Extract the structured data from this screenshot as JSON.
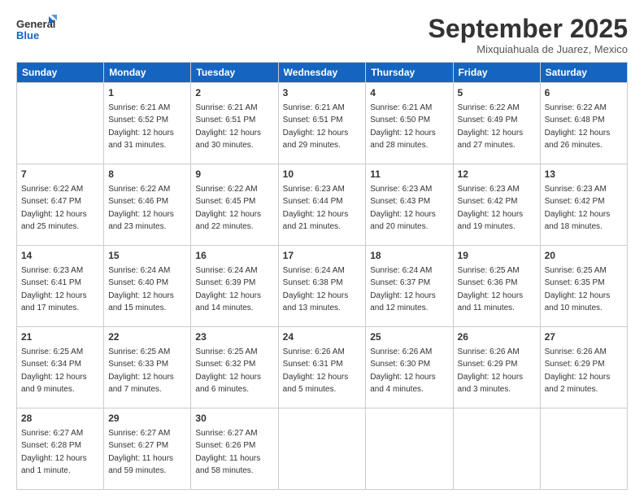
{
  "logo": {
    "line1": "General",
    "line2": "Blue"
  },
  "title": "September 2025",
  "subtitle": "Mixquiahuala de Juarez, Mexico",
  "days_of_week": [
    "Sunday",
    "Monday",
    "Tuesday",
    "Wednesday",
    "Thursday",
    "Friday",
    "Saturday"
  ],
  "weeks": [
    [
      {
        "day": "",
        "info": ""
      },
      {
        "day": "1",
        "info": "Sunrise: 6:21 AM\nSunset: 6:52 PM\nDaylight: 12 hours\nand 31 minutes."
      },
      {
        "day": "2",
        "info": "Sunrise: 6:21 AM\nSunset: 6:51 PM\nDaylight: 12 hours\nand 30 minutes."
      },
      {
        "day": "3",
        "info": "Sunrise: 6:21 AM\nSunset: 6:51 PM\nDaylight: 12 hours\nand 29 minutes."
      },
      {
        "day": "4",
        "info": "Sunrise: 6:21 AM\nSunset: 6:50 PM\nDaylight: 12 hours\nand 28 minutes."
      },
      {
        "day": "5",
        "info": "Sunrise: 6:22 AM\nSunset: 6:49 PM\nDaylight: 12 hours\nand 27 minutes."
      },
      {
        "day": "6",
        "info": "Sunrise: 6:22 AM\nSunset: 6:48 PM\nDaylight: 12 hours\nand 26 minutes."
      }
    ],
    [
      {
        "day": "7",
        "info": "Sunrise: 6:22 AM\nSunset: 6:47 PM\nDaylight: 12 hours\nand 25 minutes."
      },
      {
        "day": "8",
        "info": "Sunrise: 6:22 AM\nSunset: 6:46 PM\nDaylight: 12 hours\nand 23 minutes."
      },
      {
        "day": "9",
        "info": "Sunrise: 6:22 AM\nSunset: 6:45 PM\nDaylight: 12 hours\nand 22 minutes."
      },
      {
        "day": "10",
        "info": "Sunrise: 6:23 AM\nSunset: 6:44 PM\nDaylight: 12 hours\nand 21 minutes."
      },
      {
        "day": "11",
        "info": "Sunrise: 6:23 AM\nSunset: 6:43 PM\nDaylight: 12 hours\nand 20 minutes."
      },
      {
        "day": "12",
        "info": "Sunrise: 6:23 AM\nSunset: 6:42 PM\nDaylight: 12 hours\nand 19 minutes."
      },
      {
        "day": "13",
        "info": "Sunrise: 6:23 AM\nSunset: 6:42 PM\nDaylight: 12 hours\nand 18 minutes."
      }
    ],
    [
      {
        "day": "14",
        "info": "Sunrise: 6:23 AM\nSunset: 6:41 PM\nDaylight: 12 hours\nand 17 minutes."
      },
      {
        "day": "15",
        "info": "Sunrise: 6:24 AM\nSunset: 6:40 PM\nDaylight: 12 hours\nand 15 minutes."
      },
      {
        "day": "16",
        "info": "Sunrise: 6:24 AM\nSunset: 6:39 PM\nDaylight: 12 hours\nand 14 minutes."
      },
      {
        "day": "17",
        "info": "Sunrise: 6:24 AM\nSunset: 6:38 PM\nDaylight: 12 hours\nand 13 minutes."
      },
      {
        "day": "18",
        "info": "Sunrise: 6:24 AM\nSunset: 6:37 PM\nDaylight: 12 hours\nand 12 minutes."
      },
      {
        "day": "19",
        "info": "Sunrise: 6:25 AM\nSunset: 6:36 PM\nDaylight: 12 hours\nand 11 minutes."
      },
      {
        "day": "20",
        "info": "Sunrise: 6:25 AM\nSunset: 6:35 PM\nDaylight: 12 hours\nand 10 minutes."
      }
    ],
    [
      {
        "day": "21",
        "info": "Sunrise: 6:25 AM\nSunset: 6:34 PM\nDaylight: 12 hours\nand 9 minutes."
      },
      {
        "day": "22",
        "info": "Sunrise: 6:25 AM\nSunset: 6:33 PM\nDaylight: 12 hours\nand 7 minutes."
      },
      {
        "day": "23",
        "info": "Sunrise: 6:25 AM\nSunset: 6:32 PM\nDaylight: 12 hours\nand 6 minutes."
      },
      {
        "day": "24",
        "info": "Sunrise: 6:26 AM\nSunset: 6:31 PM\nDaylight: 12 hours\nand 5 minutes."
      },
      {
        "day": "25",
        "info": "Sunrise: 6:26 AM\nSunset: 6:30 PM\nDaylight: 12 hours\nand 4 minutes."
      },
      {
        "day": "26",
        "info": "Sunrise: 6:26 AM\nSunset: 6:29 PM\nDaylight: 12 hours\nand 3 minutes."
      },
      {
        "day": "27",
        "info": "Sunrise: 6:26 AM\nSunset: 6:29 PM\nDaylight: 12 hours\nand 2 minutes."
      }
    ],
    [
      {
        "day": "28",
        "info": "Sunrise: 6:27 AM\nSunset: 6:28 PM\nDaylight: 12 hours\nand 1 minute."
      },
      {
        "day": "29",
        "info": "Sunrise: 6:27 AM\nSunset: 6:27 PM\nDaylight: 11 hours\nand 59 minutes."
      },
      {
        "day": "30",
        "info": "Sunrise: 6:27 AM\nSunset: 6:26 PM\nDaylight: 11 hours\nand 58 minutes."
      },
      {
        "day": "",
        "info": ""
      },
      {
        "day": "",
        "info": ""
      },
      {
        "day": "",
        "info": ""
      },
      {
        "day": "",
        "info": ""
      }
    ]
  ]
}
